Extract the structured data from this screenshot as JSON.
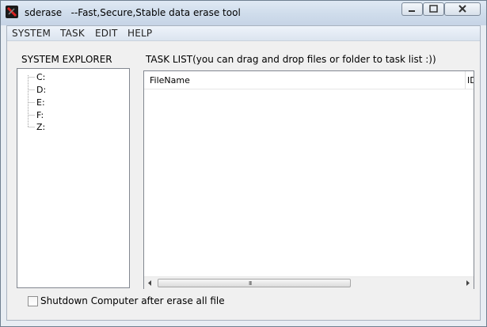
{
  "window": {
    "title": "sderase   --Fast,Secure,Stable data erase tool",
    "icon": "sderase-app-icon"
  },
  "menu": [
    "SYSTEM",
    "TASK",
    "EDIT",
    "HELP"
  ],
  "explorer": {
    "label": "SYSTEM EXPLORER",
    "drives": [
      "C:",
      "D:",
      "E:",
      "F:",
      "Z:"
    ]
  },
  "tasks": {
    "label": "TASK LIST(you can drag and drop files or folder to task list :))",
    "columns": [
      "FileName",
      "ID"
    ],
    "scroll_grip": "III"
  },
  "options": {
    "shutdown_label": "Shutdown Computer after erase all file",
    "shutdown_checked": false
  }
}
